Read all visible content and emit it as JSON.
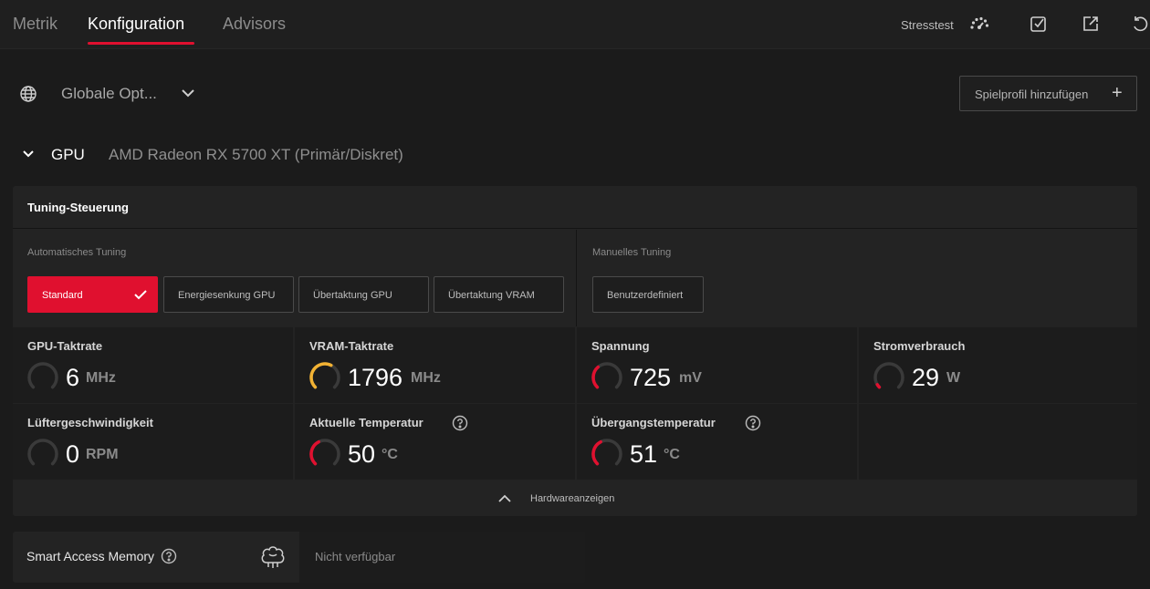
{
  "tabs": [
    {
      "label": "Metrik"
    },
    {
      "label": "Konfiguration"
    },
    {
      "label": "Advisors"
    }
  ],
  "toolbar": {
    "stresstest_label": "Stresstest",
    "icons": [
      "speedometer-icon",
      "import-icon",
      "export-icon",
      "reset-icon"
    ]
  },
  "profile": {
    "name": "Globale Opt...",
    "add_label": "Spielprofil hinzufügen"
  },
  "gpu": {
    "label": "GPU",
    "model": "AMD Radeon RX 5700 XT (Primär/Diskret)"
  },
  "tuning": {
    "title": "Tuning-Steuerung",
    "auto_label": "Automatisches Tuning",
    "manual_label": "Manuelles Tuning",
    "auto_buttons": [
      {
        "label": "Standard",
        "active": true
      },
      {
        "label": "Energiesenkung GPU",
        "active": false
      },
      {
        "label": "Übertaktung GPU",
        "active": false
      },
      {
        "label": "Übertaktung VRAM",
        "active": false
      }
    ],
    "manual_buttons": [
      {
        "label": "Benutzerdefiniert",
        "active": false
      }
    ]
  },
  "metrics": [
    {
      "title": "GPU-Taktrate",
      "value": "6",
      "unit": "MHz",
      "level": 0.0,
      "color": "#e0102f",
      "help": false
    },
    {
      "title": "VRAM-Taktrate",
      "value": "1796",
      "unit": "MHz",
      "level": 0.6,
      "color": "#f2b233",
      "help": false
    },
    {
      "title": "Spannung",
      "value": "725",
      "unit": "mV",
      "level": 0.35,
      "color": "#e0102f",
      "help": false
    },
    {
      "title": "Stromverbrauch",
      "value": "29",
      "unit": "W",
      "level": 0.05,
      "color": "#e0102f",
      "help": false
    },
    {
      "title": "Lüftergeschwindigkeit",
      "value": "0",
      "unit": "RPM",
      "level": 0.0,
      "color": "#e0102f",
      "help": false
    },
    {
      "title": "Aktuelle Temperatur",
      "value": "50",
      "unit": "°C",
      "level": 0.4,
      "color": "#e0102f",
      "help": true
    },
    {
      "title": "Übergangstemperatur",
      "value": "51",
      "unit": "°C",
      "level": 0.4,
      "color": "#e0102f",
      "help": true
    }
  ],
  "hardware_toggle_label": "Hardwareanzeigen",
  "sam": {
    "title": "Smart Access Memory",
    "value": "Nicht verfügbar"
  }
}
